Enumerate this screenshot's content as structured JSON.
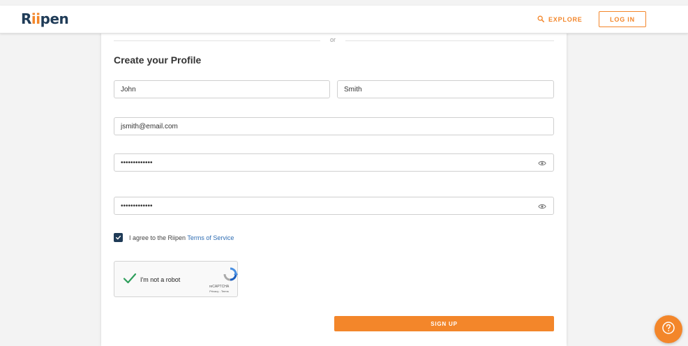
{
  "header": {
    "logo_prefix": "R",
    "logo_dots": "ii",
    "logo_suffix": "pen",
    "explore_label": "EXPLORE",
    "login_label": "LOG IN"
  },
  "divider": {
    "or_label": "or"
  },
  "form": {
    "title": "Create your Profile",
    "first_name": "John",
    "last_name": "Smith",
    "email": "jsmith@email.com",
    "password": "•••••••••••••",
    "confirm_password": "•••••••••••••",
    "agree_text": "I agree to the Riipen ",
    "terms_link": "Terms of Service",
    "agree_checked": true,
    "signup_label": "SIGN UP"
  },
  "recaptcha": {
    "label": "I'm not a robot",
    "brand": "reCAPTCHA",
    "terms": "Privacy - Terms",
    "checked": true
  },
  "colors": {
    "accent": "#f3862a",
    "brand_navy": "#1f3b57",
    "link": "#2f6db3",
    "recaptcha_check": "#2e9e5b"
  },
  "icons": {
    "explore": "search-icon",
    "password_toggle": "eye-icon",
    "help": "help-circle-icon"
  }
}
